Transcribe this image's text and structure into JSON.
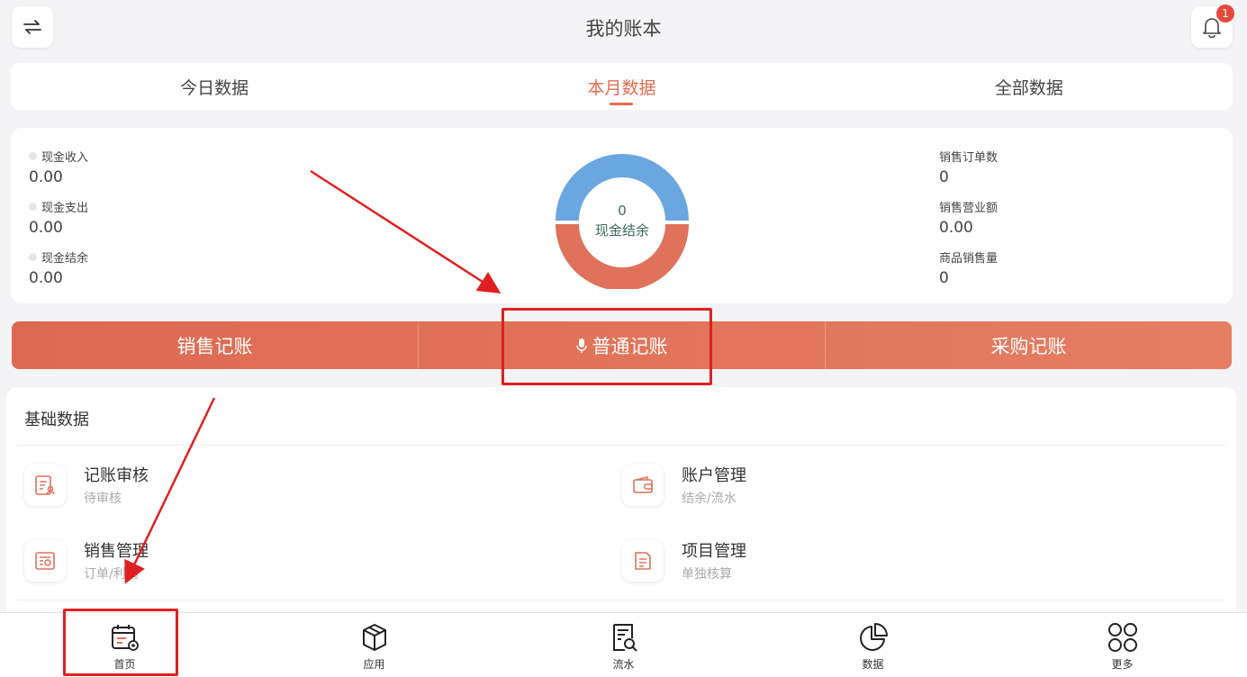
{
  "header": {
    "title": "我的账本",
    "back_icon": "swap-icon",
    "bell_icon": "bell-icon",
    "badge_count": "1"
  },
  "tabs": [
    {
      "label": "今日数据",
      "active": false
    },
    {
      "label": "本月数据",
      "active": true
    },
    {
      "label": "全部数据",
      "active": false
    }
  ],
  "stats": {
    "left": [
      {
        "label": "现金收入",
        "value": "0.00"
      },
      {
        "label": "现金支出",
        "value": "0.00"
      },
      {
        "label": "现金结余",
        "value": "0.00"
      }
    ],
    "right": [
      {
        "label": "销售订单数",
        "value": "0"
      },
      {
        "label": "销售营业额",
        "value": "0.00"
      },
      {
        "label": "商品销售量",
        "value": "0"
      }
    ],
    "donut": {
      "value": "0",
      "label": "现金结余",
      "top_color": "#6aa6e0",
      "bottom_color": "#e0715a"
    }
  },
  "actions": [
    {
      "label": "销售记账"
    },
    {
      "label": "普通记账",
      "icon": "mic-icon"
    },
    {
      "label": "采购记账"
    }
  ],
  "basic": {
    "title": "基础数据",
    "items": [
      {
        "name": "记账审核",
        "sub": "待审核",
        "icon": "audit-icon"
      },
      {
        "name": "账户管理",
        "sub": "结余/流水",
        "icon": "wallet-icon"
      },
      {
        "name": "销售管理",
        "sub": "订单/利润",
        "icon": "sales-icon"
      },
      {
        "name": "项目管理",
        "sub": "单独核算",
        "icon": "project-icon"
      }
    ]
  },
  "nav": [
    {
      "label": "首页",
      "icon": "home-calendar-icon"
    },
    {
      "label": "应用",
      "icon": "cube-icon"
    },
    {
      "label": "流水",
      "icon": "ledger-search-icon"
    },
    {
      "label": "数据",
      "icon": "pie-chart-icon"
    },
    {
      "label": "更多",
      "icon": "grid-icon"
    }
  ],
  "colors": {
    "accent": "#e36c4f",
    "highlight": "#e02020"
  }
}
